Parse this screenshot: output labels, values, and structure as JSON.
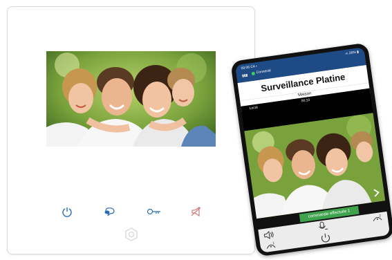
{
  "phone": {
    "status_time": "09:06 C4 •",
    "connection_status": "Connecté",
    "battery": "«ı 26% ▮",
    "title": "Surveillance Platine",
    "site_name": "Maison",
    "source_label": "Local",
    "call_duration": "00:10",
    "toast_message": "commande effectuée 1"
  },
  "colors": {
    "touch_button_blue": "#2b6cb0",
    "touch_button_red": "#c96a6a",
    "status_bar": "#1e4a86",
    "toast_green": "#3fa34d"
  },
  "icons": {
    "monitor_buttons": [
      "power-icon",
      "talk-icon",
      "key-icon",
      "mute-icon"
    ],
    "phone_controls": [
      "speaker-icon",
      "microphone-icon",
      "door-open-icon-1",
      "door-open-icon-2",
      "hang-up-icon"
    ]
  }
}
